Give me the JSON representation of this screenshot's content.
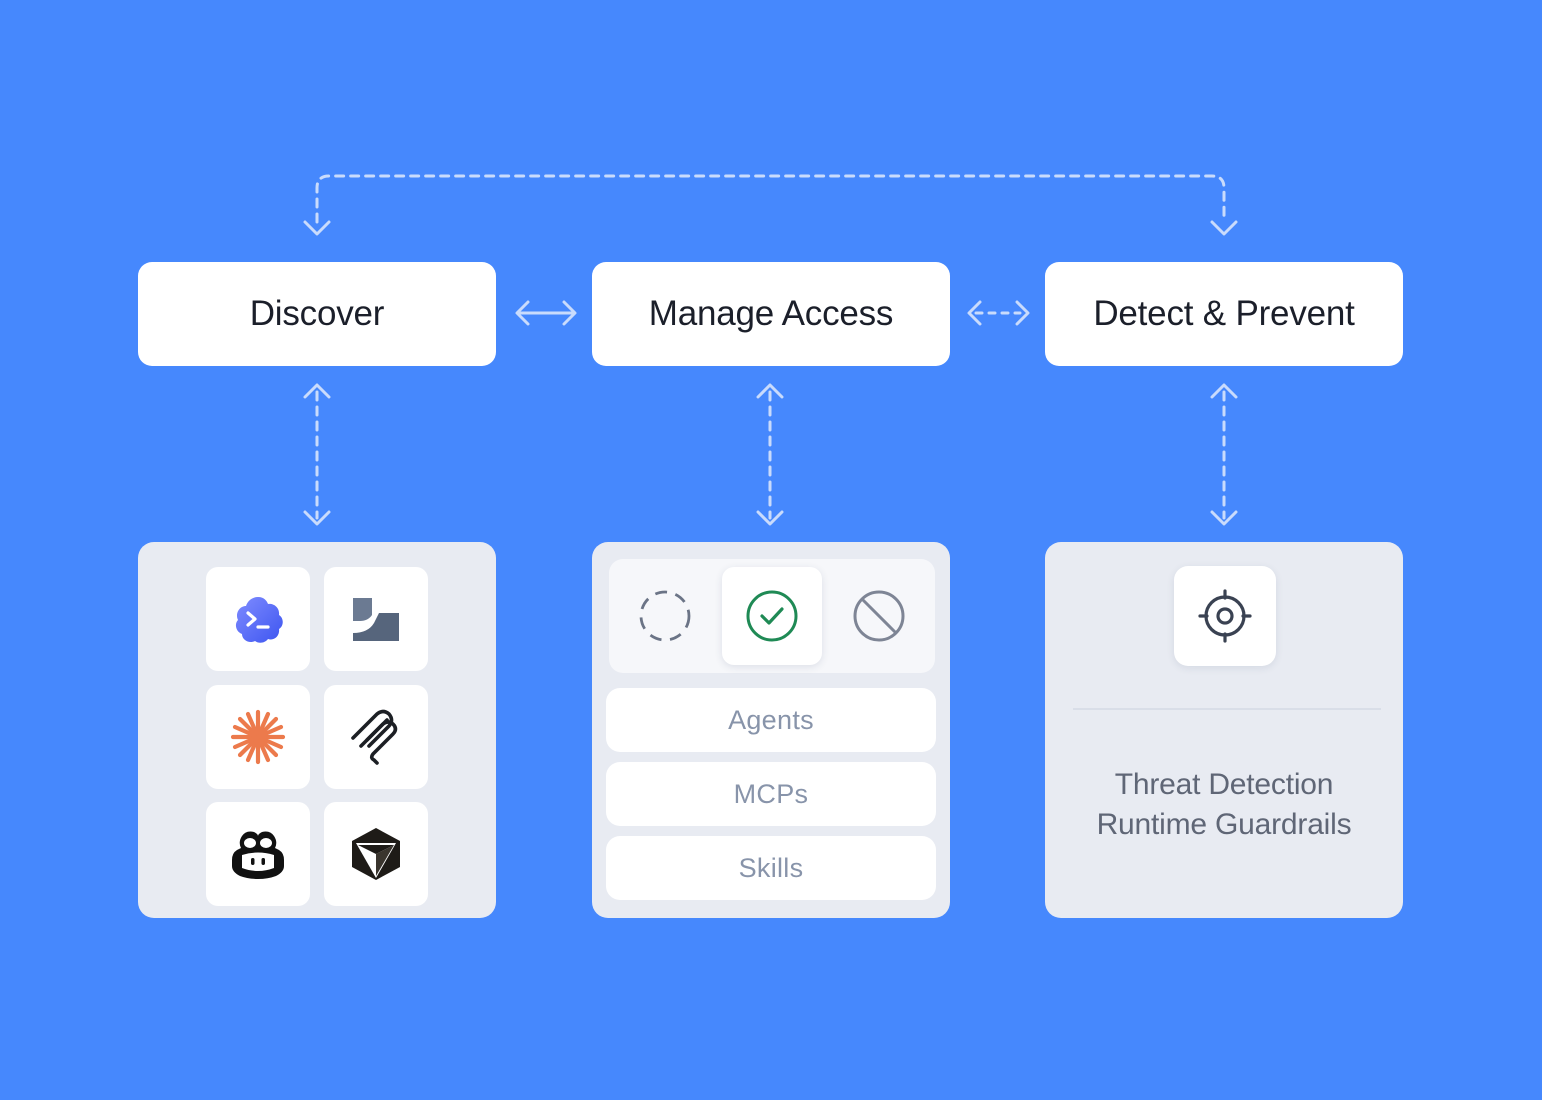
{
  "stages": {
    "discover": "Discover",
    "manage_access": "Manage Access",
    "detect_prevent": "Detect & Prevent"
  },
  "discover_panel": {
    "tools": [
      {
        "icon": "terminal-cloud-icon",
        "color": "#5b6cf5"
      },
      {
        "icon": "windsurf-icon",
        "color": "#66758c"
      },
      {
        "icon": "claude-icon",
        "color": "#e9784c"
      },
      {
        "icon": "mcp-icon",
        "color": "#1c1f24"
      },
      {
        "icon": "copilot-icon",
        "color": "#111111"
      },
      {
        "icon": "cursor-icon",
        "color": "#1e1b17"
      }
    ]
  },
  "manage_panel": {
    "statuses": [
      {
        "icon": "pending-dashed-circle-icon"
      },
      {
        "icon": "check-circle-icon",
        "color": "#1f8a55"
      },
      {
        "icon": "blocked-circle-icon"
      }
    ],
    "categories": [
      "Agents",
      "MCPs",
      "Skills"
    ]
  },
  "detect_panel": {
    "icon": "crosshair-target-icon",
    "lines": [
      "Threat Detection",
      "Runtime Guardrails"
    ]
  },
  "colors": {
    "background": "#4688fd",
    "connector": "#c9dbfc",
    "panel": "#e8ebf2"
  }
}
